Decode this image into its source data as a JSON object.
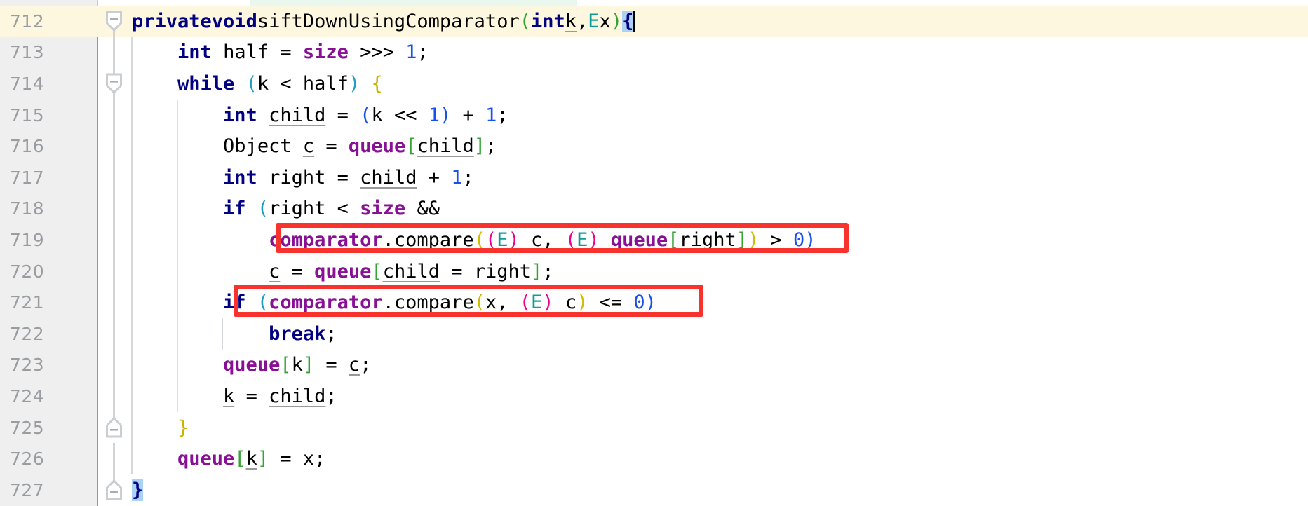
{
  "editor": {
    "language": "java",
    "colors": {
      "background": "#ffffff",
      "gutter_background": "#efefef",
      "gutter_separator": "#7e9ab8",
      "line_number": "#999da1",
      "current_line_highlight": "#fdf7e0",
      "added_line_highlight": "#e9f7ee",
      "keyword": "#000080",
      "field": "#871094",
      "number": "#1750eb",
      "type_parameter": "#0d9c9c",
      "paren_green": "#37a337",
      "paren_yellow": "#d4bb00",
      "paren_magenta": "#ec008c",
      "paren_blue": "#1750eb",
      "paren_teal": "#1f9ec4",
      "brace_olive": "#c9b400",
      "brace_match_highlight": "#a9d2f5",
      "annotation_box": "#f8332e",
      "caret": "#000000",
      "fold_marker": "#d3d3d3",
      "indent_guide": "#d5d8dc"
    },
    "lines": [
      {
        "number": "712",
        "current": true,
        "fold": "collapse-start",
        "indent_guides": 0,
        "text": "    private void siftDownUsingComparator(int k, E x) {"
      },
      {
        "number": "713",
        "current": false,
        "fold": "line",
        "indent_guides": 1,
        "text": "        int half = size >>> 1;"
      },
      {
        "number": "714",
        "current": false,
        "fold": "collapse-start",
        "indent_guides": 1,
        "text": "        while (k < half) {"
      },
      {
        "number": "715",
        "current": false,
        "fold": "line",
        "indent_guides": 2,
        "text": "            int child = (k << 1) + 1;"
      },
      {
        "number": "716",
        "current": false,
        "fold": "line",
        "indent_guides": 2,
        "text": "            Object c = queue[child];"
      },
      {
        "number": "717",
        "current": false,
        "fold": "line",
        "indent_guides": 2,
        "text": "            int right = child + 1;"
      },
      {
        "number": "718",
        "current": false,
        "fold": "line",
        "indent_guides": 2,
        "text": "            if (right < size &&"
      },
      {
        "number": "719",
        "current": false,
        "fold": "line",
        "indent_guides": 2,
        "text": "                comparator.compare((E) c, (E) queue[right]) > 0)"
      },
      {
        "number": "720",
        "current": false,
        "fold": "line",
        "indent_guides": 2,
        "text": "                c = queue[child = right];"
      },
      {
        "number": "721",
        "current": false,
        "fold": "line",
        "indent_guides": 2,
        "text": "            if (comparator.compare(x, (E) c) <= 0)"
      },
      {
        "number": "722",
        "current": false,
        "fold": "line",
        "indent_guides": 3,
        "text": "                break;"
      },
      {
        "number": "723",
        "current": false,
        "fold": "line",
        "indent_guides": 2,
        "text": "            queue[k] = c;"
      },
      {
        "number": "724",
        "current": false,
        "fold": "line",
        "indent_guides": 2,
        "text": "            k = child;"
      },
      {
        "number": "725",
        "current": false,
        "fold": "collapse-end",
        "indent_guides": 1,
        "text": "        }"
      },
      {
        "number": "726",
        "current": false,
        "fold": "line",
        "indent_guides": 1,
        "text": "        queue[k] = x;"
      },
      {
        "number": "727",
        "current": false,
        "fold": "collapse-end",
        "indent_guides": 0,
        "text": "    }"
      }
    ],
    "caret": {
      "line": "712",
      "after_token": "{"
    },
    "matched_braces": [
      "{",
      "}"
    ],
    "annotations": [
      {
        "name": "highlight-box-line-719",
        "line": "719",
        "text": "comparator.compare((E) c, (E) queue[right]) > 0)"
      },
      {
        "name": "highlight-box-line-721",
        "line": "721",
        "text": "if (comparator.compare(x, (E) c) <= 0)"
      }
    ]
  }
}
